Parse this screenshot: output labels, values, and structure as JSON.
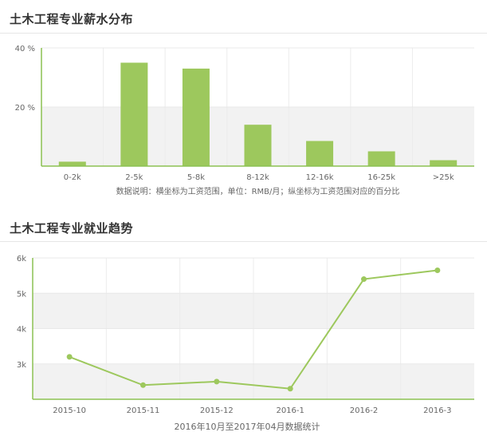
{
  "chart_data": [
    {
      "type": "bar",
      "title": "土木工程专业薪水分布",
      "categories": [
        "0-2k",
        "2-5k",
        "5-8k",
        "8-12k",
        "12-16k",
        "16-25k",
        ">25k"
      ],
      "values": [
        1.5,
        35,
        33,
        14,
        8.5,
        5,
        2
      ],
      "ylim": [
        0,
        40
      ],
      "yticks": [
        20,
        40
      ],
      "ytick_labels": [
        "20 %",
        "40 %"
      ],
      "grid": true,
      "note": "数据说明：横坐标为工资范围，单位：RMB/月；纵坐标为工资范围对应的百分比",
      "color": "#9dc85d"
    },
    {
      "type": "line",
      "title": "土木工程专业就业趋势",
      "categories": [
        "2015-10",
        "2015-11",
        "2015-12",
        "2016-1",
        "2016-2",
        "2016-3"
      ],
      "values": [
        3200,
        2400,
        2500,
        2300,
        5400,
        5650
      ],
      "ylim": [
        2000,
        6000
      ],
      "yticks": [
        3000,
        4000,
        5000,
        6000
      ],
      "ytick_labels": [
        "3k",
        "4k",
        "5k",
        "6k"
      ],
      "grid": true,
      "caption": "2016年10月至2017年04月数据统计",
      "color": "#9dc85d"
    }
  ]
}
